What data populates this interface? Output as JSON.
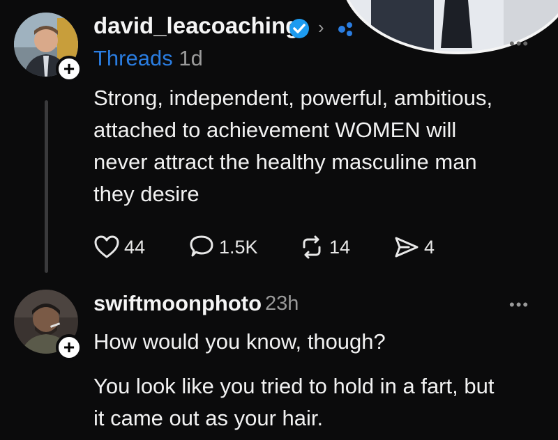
{
  "post": {
    "username": "david_leacoaching",
    "source": "Threads",
    "time": "1d",
    "text_lines": [
      "Strong, independent, powerful, ambitious,",
      "attached to achievement WOMEN will",
      "never attract the healthy masculine man",
      "they desire"
    ],
    "likes": "44",
    "replies": "1.5K",
    "reposts": "14",
    "shares": "4",
    "verified_icon": "verified-badge-icon",
    "follow_icon": "plus-icon"
  },
  "reply": {
    "username": "swiftmoonphoto",
    "time": "23h",
    "text_lines_1": [
      "How would you know, though?"
    ],
    "text_lines_2": [
      "You look like you tried to hold in a fart, but",
      "it came out as your hair."
    ],
    "more_label": "•••",
    "follow_icon": "plus-icon"
  },
  "colors": {
    "background": "#0b0b0c",
    "text": "#f2f2f2",
    "link_blue": "#2a7de1",
    "muted": "#9a9a9a",
    "verified": "#1d9bf0"
  }
}
